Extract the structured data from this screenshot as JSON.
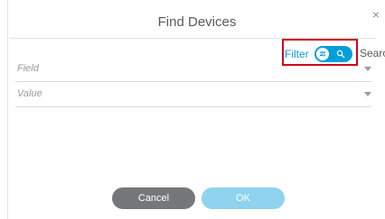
{
  "dialog": {
    "title": "Find Devices",
    "close_symbol": "×"
  },
  "filter_toggle": {
    "filter_label": "Filter",
    "search_label": "Search",
    "state": "filter",
    "knob_icon": "filter-icon",
    "alt_icon": "search-icon",
    "accent_color": "#049fd9",
    "highlight_color": "#d0021b"
  },
  "fields": {
    "field_placeholder": "Field",
    "value_placeholder": "Value"
  },
  "buttons": {
    "cancel_label": "Cancel",
    "ok_label": "OK",
    "cancel_color": "#767778",
    "ok_color": "#8fd3ef"
  }
}
